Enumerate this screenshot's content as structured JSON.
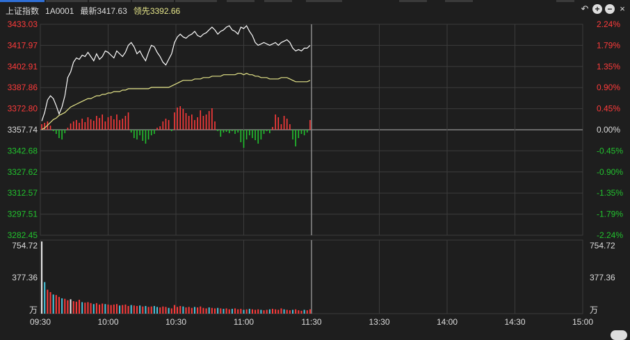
{
  "header": {
    "index_name": "上证指数",
    "code": "1A0001",
    "latest_label": "最新",
    "latest_value": "3417.63",
    "leading_label": "领先",
    "leading_value": "3392.66"
  },
  "controls": {
    "back_icon": "undo-arrow-icon",
    "zoom_in_icon": "plus-circle-icon",
    "zoom_out_icon": "minus-circle-icon",
    "close_icon": "close-icon",
    "back_glyph": "↶",
    "zoom_in_glyph": "+",
    "zoom_out_glyph": "−",
    "close_glyph": "×"
  },
  "colors": {
    "up": "#ff3b3b",
    "down": "#22c32e",
    "neutral": "#dddddd",
    "price_line": "#ffffff",
    "avg_line": "#e6e68a",
    "grid": "#3c3c3c",
    "vol_cyan": "#49c8e0",
    "bg": "#1e1e1e"
  },
  "chart_data": {
    "type": "line",
    "prev_close": 3357.74,
    "price_ticks": [
      "3433.03",
      "3417.97",
      "3402.91",
      "3387.86",
      "3372.80",
      "3357.74",
      "3342.68",
      "3327.62",
      "3312.57",
      "3297.51",
      "3282.45"
    ],
    "pct_ticks": [
      "2.24%",
      "1.79%",
      "1.35%",
      "0.90%",
      "0.45%",
      "0.00%",
      "-0.45%",
      "-0.90%",
      "-1.35%",
      "-1.79%",
      "-2.24%"
    ],
    "ylim": [
      3282.45,
      3433.03
    ],
    "time_ticks": [
      "09:30",
      "10:00",
      "10:30",
      "11:00",
      "11:30",
      "13:30",
      "14:00",
      "14:30",
      "15:00"
    ],
    "volume_ticks": [
      "754.72",
      "377.36"
    ],
    "volume_unit": "万",
    "volume_max": 754.72,
    "series": [
      {
        "key": "price",
        "values": [
          3364,
          3370,
          3379,
          3382,
          3380,
          3375,
          3369,
          3374,
          3382,
          3395,
          3399,
          3406,
          3409,
          3408,
          3411,
          3410,
          3413,
          3410,
          3407,
          3412,
          3408,
          3410,
          3414,
          3413,
          3411,
          3409,
          3414,
          3412,
          3410,
          3413,
          3418,
          3420,
          3417,
          3412,
          3414,
          3410,
          3407,
          3413,
          3418,
          3417,
          3413,
          3410,
          3406,
          3404,
          3408,
          3412,
          3420,
          3424,
          3426,
          3424,
          3423,
          3425,
          3426,
          3428,
          3425,
          3424,
          3426,
          3427,
          3429,
          3431,
          3429,
          3426,
          3428,
          3429,
          3431,
          3432,
          3429,
          3428,
          3426,
          3431,
          3430,
          3432,
          3428,
          3425,
          3420,
          3418,
          3419,
          3420,
          3419,
          3418,
          3419,
          3420,
          3418,
          3420,
          3421,
          3422,
          3420,
          3416,
          3414,
          3415,
          3414,
          3416,
          3416,
          3418
        ]
      },
      {
        "key": "avg",
        "values": [
          3358,
          3359,
          3361,
          3363,
          3365,
          3366,
          3368,
          3369,
          3370,
          3372,
          3374,
          3375,
          3376,
          3377,
          3378,
          3379,
          3380,
          3380,
          3381,
          3382,
          3382,
          3383,
          3383,
          3384,
          3384,
          3385,
          3385,
          3385,
          3386,
          3386,
          3387,
          3387,
          3387,
          3387,
          3387,
          3387,
          3387,
          3387,
          3388,
          3388,
          3388,
          3388,
          3388,
          3388,
          3388,
          3389,
          3390,
          3391,
          3392,
          3393,
          3393,
          3393,
          3393,
          3394,
          3394,
          3394,
          3395,
          3395,
          3395,
          3396,
          3396,
          3396,
          3396,
          3397,
          3397,
          3397,
          3397,
          3397,
          3398,
          3398,
          3397,
          3398,
          3397,
          3397,
          3396,
          3396,
          3395,
          3395,
          3395,
          3394,
          3394,
          3394,
          3394,
          3395,
          3395,
          3395,
          3394,
          3393,
          3392,
          3392,
          3392,
          3392,
          3392,
          3393
        ]
      },
      {
        "key": "ratio_bars",
        "values": [
          8,
          10,
          12,
          6,
          -2,
          -6,
          -12,
          -14,
          -5,
          3,
          9,
          12,
          14,
          10,
          16,
          11,
          18,
          15,
          13,
          20,
          17,
          22,
          12,
          18,
          20,
          15,
          22,
          14,
          16,
          20,
          25,
          -4,
          -12,
          -14,
          -8,
          -16,
          -20,
          -14,
          -8,
          -6,
          3,
          5,
          12,
          16,
          14,
          -2,
          25,
          32,
          34,
          30,
          24,
          20,
          22,
          14,
          18,
          28,
          20,
          22,
          27,
          31,
          12,
          -2,
          -10,
          -4,
          -3,
          -5,
          -2,
          -6,
          -4,
          -18,
          -26,
          -14,
          -8,
          -12,
          -15,
          -20,
          -14,
          -6,
          -2,
          -5,
          4,
          22,
          18,
          8,
          20,
          16,
          8,
          -14,
          -24,
          -12,
          -6,
          -8,
          -4,
          14
        ]
      },
      {
        "key": "volume",
        "values": [
          755,
          330,
          250,
          225,
          200,
          195,
          175,
          160,
          155,
          140,
          150,
          130,
          125,
          145,
          120,
          115,
          120,
          110,
          100,
          110,
          95,
          105,
          100,
          95,
          90,
          95,
          100,
          85,
          90,
          95,
          80,
          90,
          85,
          80,
          85,
          75,
          80,
          70,
          75,
          80,
          70,
          65,
          75,
          70,
          60,
          55,
          90,
          70,
          80,
          75,
          65,
          70,
          60,
          70,
          65,
          75,
          60,
          55,
          65,
          60,
          55,
          60,
          55,
          50,
          55,
          45,
          50,
          55,
          45,
          50,
          40,
          45,
          50,
          45,
          40,
          45,
          40,
          35,
          40,
          45,
          50,
          45,
          40,
          55,
          45,
          40,
          35,
          40,
          45,
          35,
          30,
          40,
          35,
          45
        ]
      },
      {
        "key": "volume_color",
        "values": [
          "w",
          "c",
          "r",
          "r",
          "c",
          "r",
          "r",
          "c",
          "r",
          "r",
          "w",
          "r",
          "r",
          "r",
          "c",
          "r",
          "r",
          "r",
          "c",
          "r",
          "r",
          "r",
          "c",
          "r",
          "r",
          "r",
          "r",
          "c",
          "r",
          "r",
          "r",
          "c",
          "r",
          "r",
          "c",
          "r",
          "c",
          "r",
          "r",
          "c",
          "c",
          "r",
          "r",
          "r",
          "c",
          "r",
          "r",
          "r",
          "r",
          "c",
          "r",
          "r",
          "r",
          "c",
          "r",
          "r",
          "r",
          "r",
          "c",
          "r",
          "r",
          "c",
          "r",
          "c",
          "r",
          "r",
          "c",
          "r",
          "r",
          "r",
          "c",
          "r",
          "c",
          "r",
          "r",
          "r",
          "c",
          "r",
          "r",
          "c",
          "r",
          "r",
          "r",
          "r",
          "c",
          "r",
          "r",
          "c",
          "r",
          "r",
          "r",
          "c",
          "r",
          "r"
        ]
      }
    ]
  }
}
